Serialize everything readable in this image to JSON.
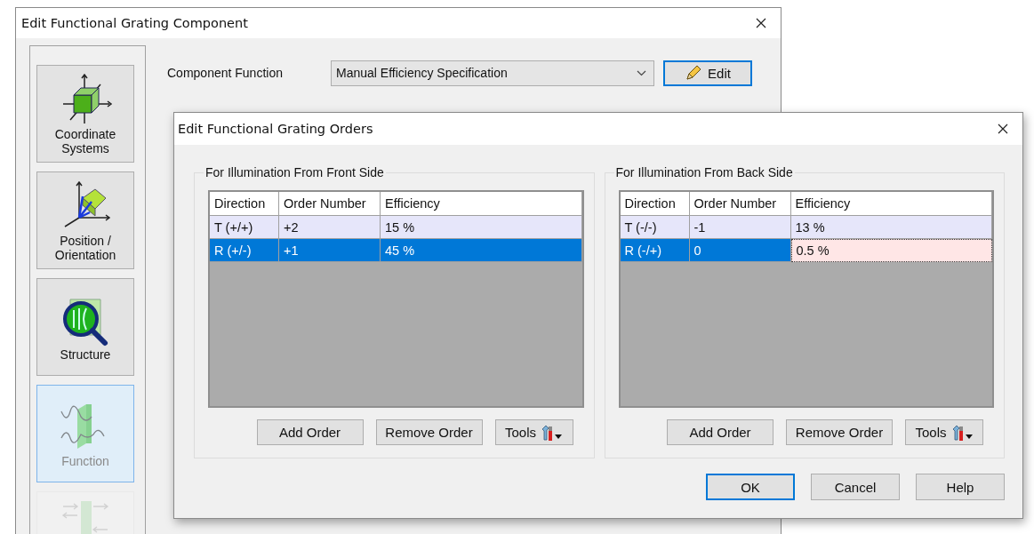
{
  "main_window": {
    "title": "Edit Functional Grating Component",
    "sidebar": {
      "items": [
        {
          "kind": "coordinates",
          "label": "Coordinate Systems",
          "selected": false,
          "disabled": false
        },
        {
          "kind": "position",
          "label": "Position / Orientation",
          "selected": false,
          "disabled": false
        },
        {
          "kind": "structure",
          "label": "Structure",
          "selected": false,
          "disabled": false
        },
        {
          "kind": "function",
          "label": "Function",
          "selected": true,
          "disabled": false
        },
        {
          "kind": "conversion",
          "selected": false,
          "disabled": true
        }
      ]
    },
    "component_function": {
      "label": "Component Function",
      "value": "Manual Efficiency Specification",
      "edit_button": "Edit"
    }
  },
  "dialog": {
    "title": "Edit Functional Grating Orders",
    "groups": [
      {
        "title": "For Illumination From Front Side",
        "columns": [
          "Direction",
          "Order Number",
          "Efficiency"
        ],
        "rows": [
          {
            "cells": [
              "T (+/+)",
              "+2",
              "15 %"
            ],
            "selected": false,
            "editing": false
          },
          {
            "cells": [
              "R (+/-)",
              "+1",
              "45 %"
            ],
            "selected": true,
            "editing": false
          }
        ],
        "buttons": [
          "Add Order",
          "Remove Order"
        ],
        "tools_button": "Tools"
      },
      {
        "title": "For Illumination From Back Side",
        "columns": [
          "Direction",
          "Order Number",
          "Efficiency"
        ],
        "rows": [
          {
            "cells": [
              "T (-/-)",
              "-1",
              "13 %"
            ],
            "selected": false,
            "editing": false
          },
          {
            "cells": [
              "R (-/+)",
              "0",
              "0.5 %"
            ],
            "selected": true,
            "editing": true
          }
        ],
        "buttons": [
          "Add Order",
          "Remove Order"
        ],
        "tools_button": "Tools"
      }
    ],
    "buttons": [
      {
        "label": "OK",
        "default": true
      },
      {
        "label": "Cancel",
        "default": false
      },
      {
        "label": "Help",
        "default": false
      }
    ]
  }
}
